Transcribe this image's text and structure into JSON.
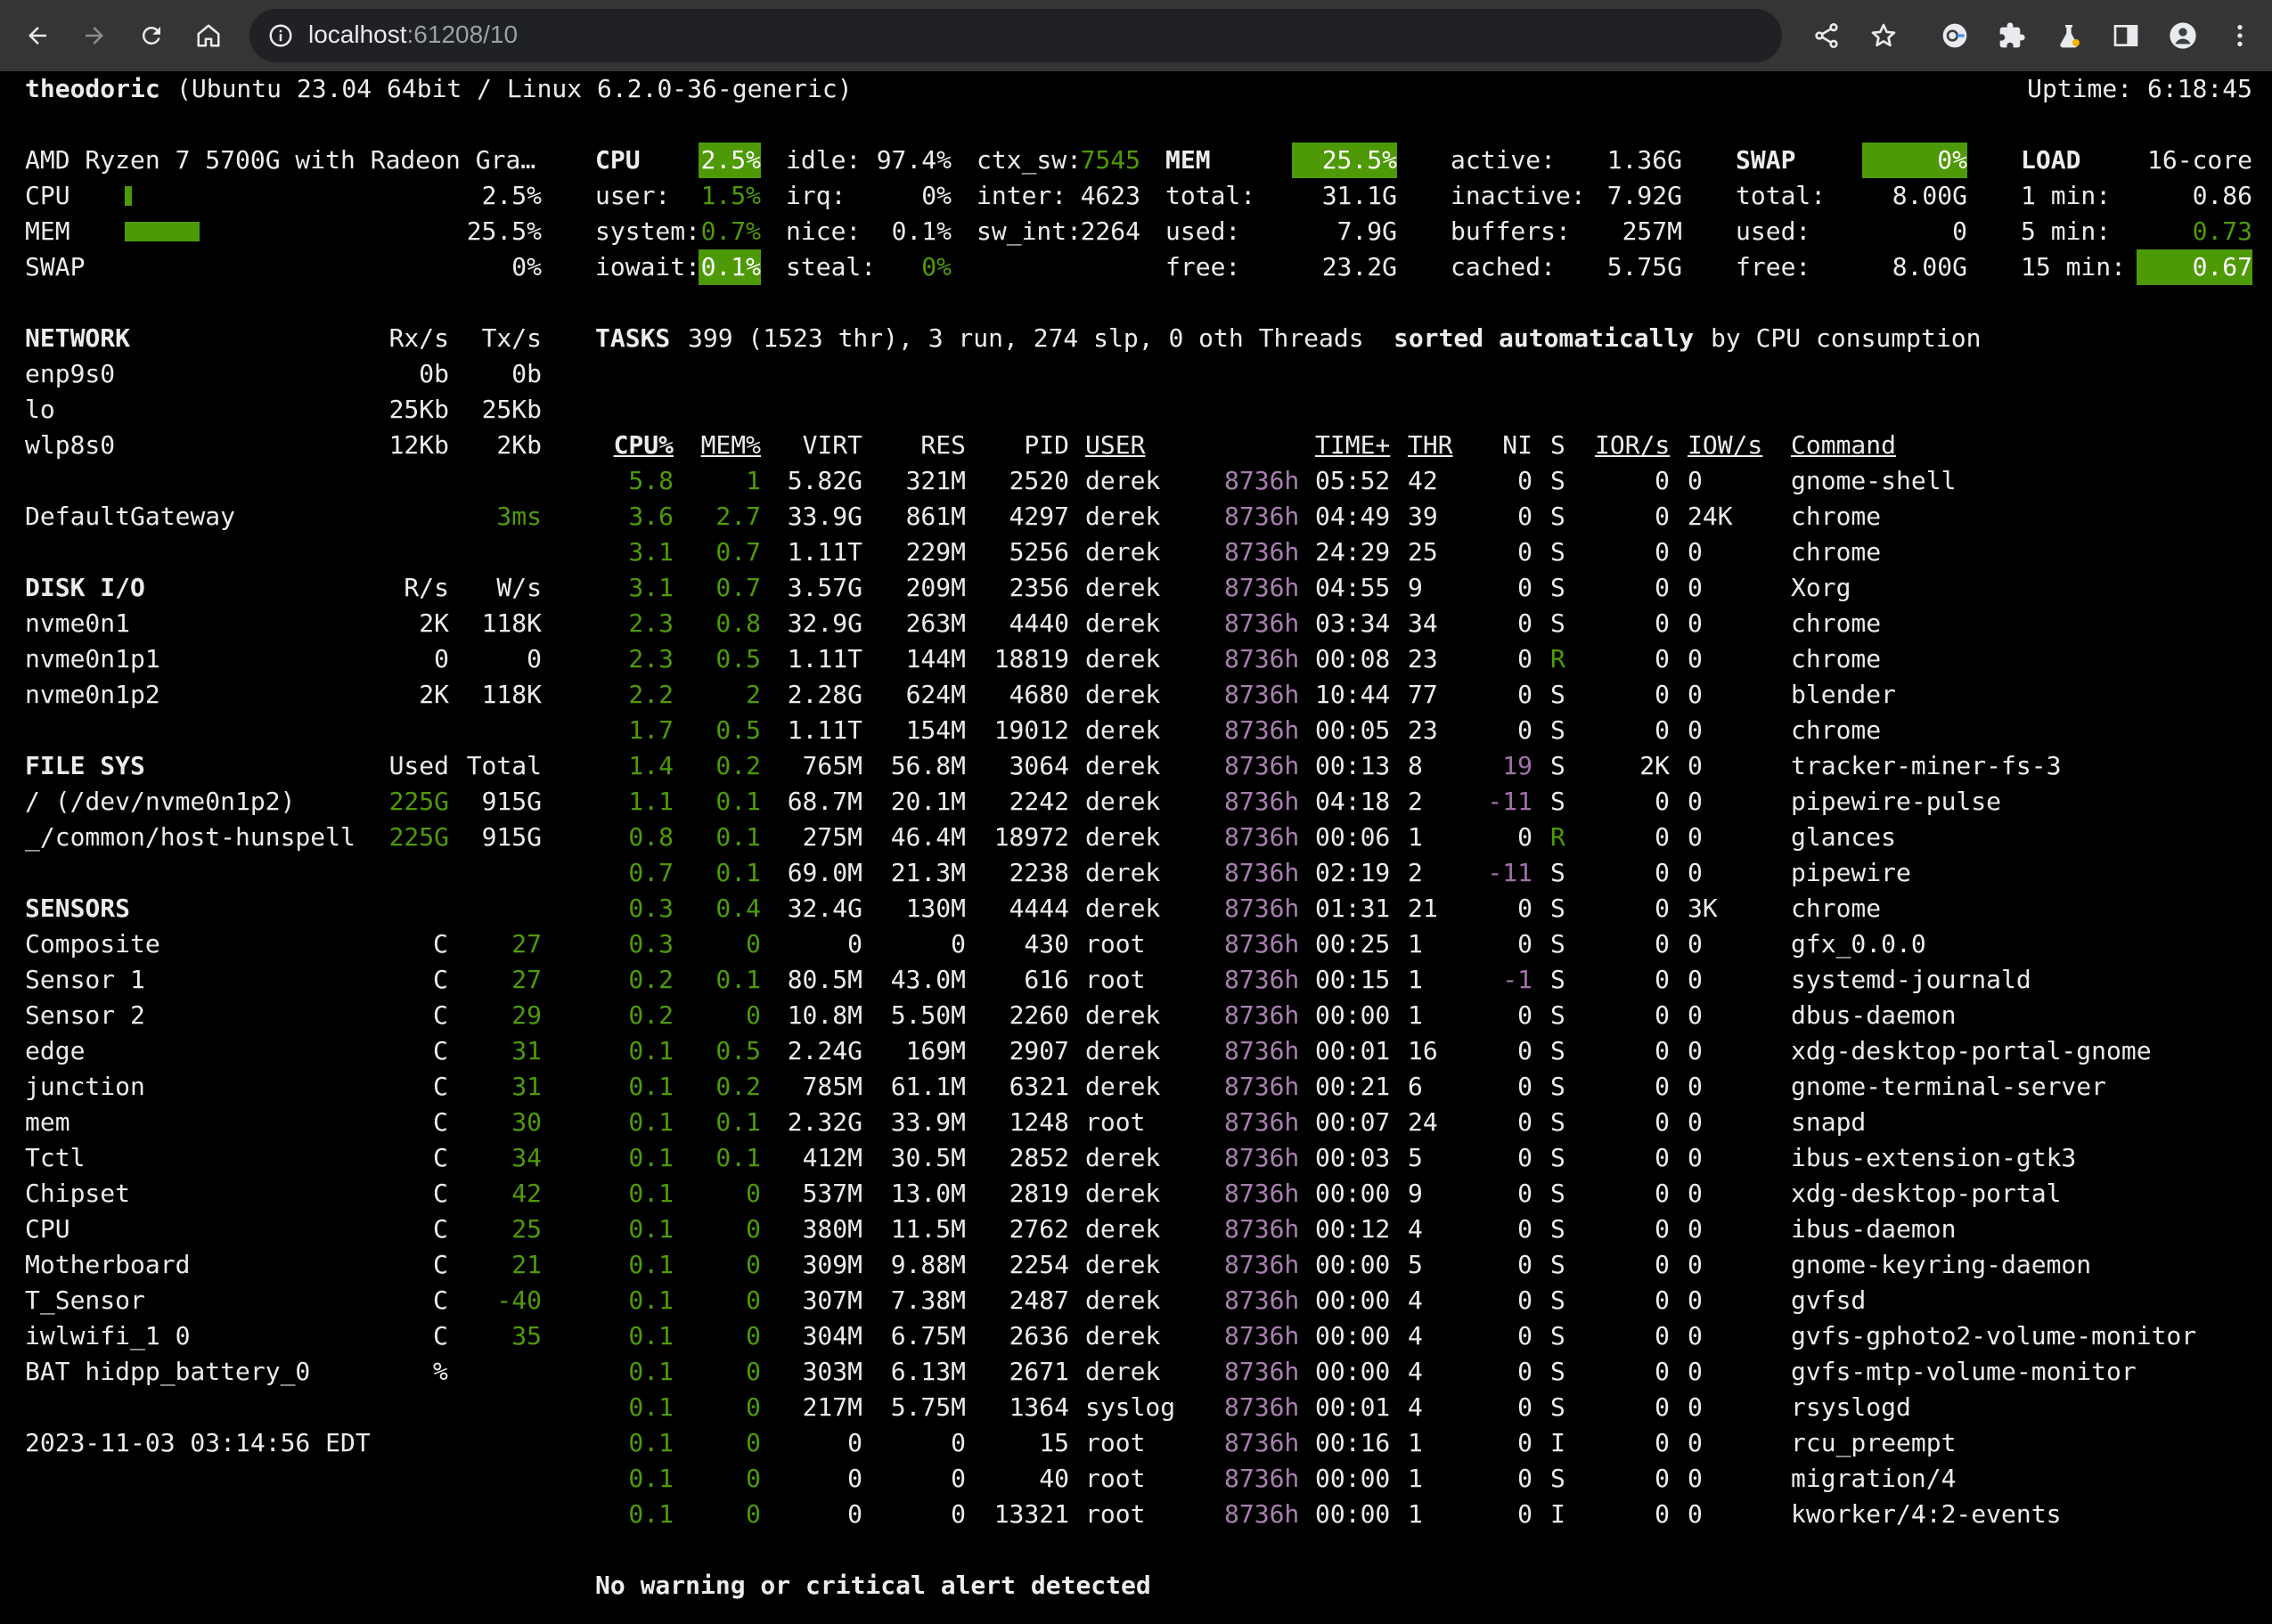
{
  "browser": {
    "url_host": "localhost",
    "url_rest": ":61208/10"
  },
  "header": {
    "hostname": "theodoric",
    "os": "(Ubuntu 23.04 64bit / Linux 6.2.0-36-generic)",
    "uptime": "Uptime: 6:18:45"
  },
  "quicklook": {
    "cpu_name": "AMD Ryzen 7 5700G with Radeon Gra…",
    "rows": [
      {
        "label": "CPU",
        "value": "2.5%",
        "fraction": 0.025
      },
      {
        "label": "MEM",
        "value": "25.5%",
        "fraction": 0.255
      },
      {
        "label": "SWAP",
        "value": "0%",
        "fraction": 0.0
      }
    ]
  },
  "cpu": {
    "title": "CPU",
    "total": "2.5%",
    "user_l": "user:",
    "user": "1.5%",
    "system_l": "system:",
    "system": "0.7%",
    "iowait_l": "iowait:",
    "iowait": "0.1%",
    "idle_l": "idle:",
    "idle": "97.4%",
    "irq_l": "irq:",
    "irq": "0%",
    "nice_l": "nice:",
    "nice": "0.1%",
    "steal_l": "steal:",
    "steal": "0%",
    "ctx_l": "ctx_sw:",
    "ctx": "7545",
    "inter_l": "inter:",
    "inter": "4623",
    "swint_l": "sw_int:",
    "swint": "2264"
  },
  "mem": {
    "title": "MEM",
    "pct": "25.5%",
    "total_l": "total:",
    "total": "31.1G",
    "used_l": "used:",
    "used": "7.9G",
    "free_l": "free:",
    "free": "23.2G",
    "active_l": "active:",
    "active": "1.36G",
    "inactive_l": "inactive:",
    "inactive": "7.92G",
    "buffers_l": "buffers:",
    "buffers": "257M",
    "cached_l": "cached:",
    "cached": "5.75G"
  },
  "swap": {
    "title": "SWAP",
    "pct": "0%",
    "total_l": "total:",
    "total": "8.00G",
    "used_l": "used:",
    "used": "0",
    "free_l": "free:",
    "free": "8.00G"
  },
  "load": {
    "title": "LOAD",
    "cores": "16-core",
    "m1_l": "1 min:",
    "m1": "0.86",
    "m5_l": "5 min:",
    "m5": "0.73",
    "m15_l": "15 min:",
    "m15": "0.67"
  },
  "network": {
    "title": "NETWORK",
    "rx": "Rx/s",
    "tx": "Tx/s",
    "rows": [
      {
        "name": "enp9s0",
        "rx": "0b",
        "tx": "0b"
      },
      {
        "name": "lo",
        "rx": "25Kb",
        "tx": "25Kb"
      },
      {
        "name": "wlp8s0",
        "rx": "12Kb",
        "tx": "2Kb"
      }
    ]
  },
  "gateway": {
    "name": "DefaultGateway",
    "value": "3ms"
  },
  "disk": {
    "title": "DISK I/O",
    "r": "R/s",
    "w": "W/s",
    "rows": [
      {
        "name": "nvme0n1",
        "r": "2K",
        "w": "118K"
      },
      {
        "name": "nvme0n1p1",
        "r": "0",
        "w": "0"
      },
      {
        "name": "nvme0n1p2",
        "r": "2K",
        "w": "118K"
      }
    ]
  },
  "fs": {
    "title": "FILE SYS",
    "used": "Used",
    "total": "Total",
    "rows": [
      {
        "name": "/ (/dev/nvme0n1p2)",
        "used": "225G",
        "total": "915G"
      },
      {
        "name": "_/common/host-hunspell",
        "used": "225G",
        "total": "915G"
      }
    ]
  },
  "sensors": {
    "title": "SENSORS",
    "rows": [
      {
        "name": "Composite",
        "unit": "C",
        "value": "27"
      },
      {
        "name": "Sensor 1",
        "unit": "C",
        "value": "27"
      },
      {
        "name": "Sensor 2",
        "unit": "C",
        "value": "29"
      },
      {
        "name": "edge",
        "unit": "C",
        "value": "31"
      },
      {
        "name": "junction",
        "unit": "C",
        "value": "31"
      },
      {
        "name": "mem",
        "unit": "C",
        "value": "30"
      },
      {
        "name": "Tctl",
        "unit": "C",
        "value": "34"
      },
      {
        "name": "Chipset",
        "unit": "C",
        "value": "42"
      },
      {
        "name": "CPU",
        "unit": "C",
        "value": "25"
      },
      {
        "name": "Motherboard",
        "unit": "C",
        "value": "21"
      },
      {
        "name": "T_Sensor",
        "unit": "C",
        "value": "-40"
      },
      {
        "name": "iwlwifi_1 0",
        "unit": "C",
        "value": "35"
      },
      {
        "name": "BAT hidpp_battery_0",
        "unit": "%",
        "value": ""
      }
    ]
  },
  "datetime": "2023-11-03 03:14:56 EDT",
  "tasks": {
    "title": "TASKS",
    "summary": "399 (1523 thr), 3 run, 274 slp, 0 oth Threads",
    "sorted": "sorted automatically",
    "by": "by CPU consumption"
  },
  "proc_headers": {
    "cpu": "CPU%",
    "mem": "MEM%",
    "virt": "VIRT",
    "res": "RES",
    "pid": "PID",
    "user": "USER",
    "time": "TIME+",
    "thr": "THR",
    "ni": "NI",
    "s": "S",
    "ior": "IOR/s",
    "iow": "IOW/s",
    "cmd": "Command"
  },
  "processes": [
    {
      "cpu": "5.8",
      "mem": "1",
      "virt": "5.82G",
      "res": "321M",
      "pid": "2520",
      "user": "derek",
      "th": "8736h",
      "tm": "05:52",
      "thr": "42",
      "ni": "0",
      "s": "S",
      "ior": "0",
      "iow": "0",
      "cmd": "gnome-shell"
    },
    {
      "cpu": "3.6",
      "mem": "2.7",
      "virt": "33.9G",
      "res": "861M",
      "pid": "4297",
      "user": "derek",
      "th": "8736h",
      "tm": "04:49",
      "thr": "39",
      "ni": "0",
      "s": "S",
      "ior": "0",
      "iow": "24K",
      "cmd": "chrome"
    },
    {
      "cpu": "3.1",
      "mem": "0.7",
      "virt": "1.11T",
      "res": "229M",
      "pid": "5256",
      "user": "derek",
      "th": "8736h",
      "tm": "24:29",
      "thr": "25",
      "ni": "0",
      "s": "S",
      "ior": "0",
      "iow": "0",
      "cmd": "chrome"
    },
    {
      "cpu": "3.1",
      "mem": "0.7",
      "virt": "3.57G",
      "res": "209M",
      "pid": "2356",
      "user": "derek",
      "th": "8736h",
      "tm": "04:55",
      "thr": "9",
      "ni": "0",
      "s": "S",
      "ior": "0",
      "iow": "0",
      "cmd": "Xorg"
    },
    {
      "cpu": "2.3",
      "mem": "0.8",
      "virt": "32.9G",
      "res": "263M",
      "pid": "4440",
      "user": "derek",
      "th": "8736h",
      "tm": "03:34",
      "thr": "34",
      "ni": "0",
      "s": "S",
      "ior": "0",
      "iow": "0",
      "cmd": "chrome"
    },
    {
      "cpu": "2.3",
      "mem": "0.5",
      "virt": "1.11T",
      "res": "144M",
      "pid": "18819",
      "user": "derek",
      "th": "8736h",
      "tm": "00:08",
      "thr": "23",
      "ni": "0",
      "s": "R",
      "ior": "0",
      "iow": "0",
      "cmd": "chrome"
    },
    {
      "cpu": "2.2",
      "mem": "2",
      "virt": "2.28G",
      "res": "624M",
      "pid": "4680",
      "user": "derek",
      "th": "8736h",
      "tm": "10:44",
      "thr": "77",
      "ni": "0",
      "s": "S",
      "ior": "0",
      "iow": "0",
      "cmd": "blender"
    },
    {
      "cpu": "1.7",
      "mem": "0.5",
      "virt": "1.11T",
      "res": "154M",
      "pid": "19012",
      "user": "derek",
      "th": "8736h",
      "tm": "00:05",
      "thr": "23",
      "ni": "0",
      "s": "S",
      "ior": "0",
      "iow": "0",
      "cmd": "chrome"
    },
    {
      "cpu": "1.4",
      "mem": "0.2",
      "virt": "765M",
      "res": "56.8M",
      "pid": "3064",
      "user": "derek",
      "th": "8736h",
      "tm": "00:13",
      "thr": "8",
      "ni": "19",
      "s": "S",
      "ior": "2K",
      "iow": "0",
      "cmd": "tracker-miner-fs-3"
    },
    {
      "cpu": "1.1",
      "mem": "0.1",
      "virt": "68.7M",
      "res": "20.1M",
      "pid": "2242",
      "user": "derek",
      "th": "8736h",
      "tm": "04:18",
      "thr": "2",
      "ni": "-11",
      "s": "S",
      "ior": "0",
      "iow": "0",
      "cmd": "pipewire-pulse"
    },
    {
      "cpu": "0.8",
      "mem": "0.1",
      "virt": "275M",
      "res": "46.4M",
      "pid": "18972",
      "user": "derek",
      "th": "8736h",
      "tm": "00:06",
      "thr": "1",
      "ni": "0",
      "s": "R",
      "ior": "0",
      "iow": "0",
      "cmd": "glances"
    },
    {
      "cpu": "0.7",
      "mem": "0.1",
      "virt": "69.0M",
      "res": "21.3M",
      "pid": "2238",
      "user": "derek",
      "th": "8736h",
      "tm": "02:19",
      "thr": "2",
      "ni": "-11",
      "s": "S",
      "ior": "0",
      "iow": "0",
      "cmd": "pipewire"
    },
    {
      "cpu": "0.3",
      "mem": "0.4",
      "virt": "32.4G",
      "res": "130M",
      "pid": "4444",
      "user": "derek",
      "th": "8736h",
      "tm": "01:31",
      "thr": "21",
      "ni": "0",
      "s": "S",
      "ior": "0",
      "iow": "3K",
      "cmd": "chrome"
    },
    {
      "cpu": "0.3",
      "mem": "0",
      "virt": "0",
      "res": "0",
      "pid": "430",
      "user": "root",
      "th": "8736h",
      "tm": "00:25",
      "thr": "1",
      "ni": "0",
      "s": "S",
      "ior": "0",
      "iow": "0",
      "cmd": "gfx_0.0.0"
    },
    {
      "cpu": "0.2",
      "mem": "0.1",
      "virt": "80.5M",
      "res": "43.0M",
      "pid": "616",
      "user": "root",
      "th": "8736h",
      "tm": "00:15",
      "thr": "1",
      "ni": "-1",
      "s": "S",
      "ior": "0",
      "iow": "0",
      "cmd": "systemd-journald"
    },
    {
      "cpu": "0.2",
      "mem": "0",
      "virt": "10.8M",
      "res": "5.50M",
      "pid": "2260",
      "user": "derek",
      "th": "8736h",
      "tm": "00:00",
      "thr": "1",
      "ni": "0",
      "s": "S",
      "ior": "0",
      "iow": "0",
      "cmd": "dbus-daemon"
    },
    {
      "cpu": "0.1",
      "mem": "0.5",
      "virt": "2.24G",
      "res": "169M",
      "pid": "2907",
      "user": "derek",
      "th": "8736h",
      "tm": "00:01",
      "thr": "16",
      "ni": "0",
      "s": "S",
      "ior": "0",
      "iow": "0",
      "cmd": "xdg-desktop-portal-gnome"
    },
    {
      "cpu": "0.1",
      "mem": "0.2",
      "virt": "785M",
      "res": "61.1M",
      "pid": "6321",
      "user": "derek",
      "th": "8736h",
      "tm": "00:21",
      "thr": "6",
      "ni": "0",
      "s": "S",
      "ior": "0",
      "iow": "0",
      "cmd": "gnome-terminal-server"
    },
    {
      "cpu": "0.1",
      "mem": "0.1",
      "virt": "2.32G",
      "res": "33.9M",
      "pid": "1248",
      "user": "root",
      "th": "8736h",
      "tm": "00:07",
      "thr": "24",
      "ni": "0",
      "s": "S",
      "ior": "0",
      "iow": "0",
      "cmd": "snapd"
    },
    {
      "cpu": "0.1",
      "mem": "0.1",
      "virt": "412M",
      "res": "30.5M",
      "pid": "2852",
      "user": "derek",
      "th": "8736h",
      "tm": "00:03",
      "thr": "5",
      "ni": "0",
      "s": "S",
      "ior": "0",
      "iow": "0",
      "cmd": "ibus-extension-gtk3"
    },
    {
      "cpu": "0.1",
      "mem": "0",
      "virt": "537M",
      "res": "13.0M",
      "pid": "2819",
      "user": "derek",
      "th": "8736h",
      "tm": "00:00",
      "thr": "9",
      "ni": "0",
      "s": "S",
      "ior": "0",
      "iow": "0",
      "cmd": "xdg-desktop-portal"
    },
    {
      "cpu": "0.1",
      "mem": "0",
      "virt": "380M",
      "res": "11.5M",
      "pid": "2762",
      "user": "derek",
      "th": "8736h",
      "tm": "00:12",
      "thr": "4",
      "ni": "0",
      "s": "S",
      "ior": "0",
      "iow": "0",
      "cmd": "ibus-daemon"
    },
    {
      "cpu": "0.1",
      "mem": "0",
      "virt": "309M",
      "res": "9.88M",
      "pid": "2254",
      "user": "derek",
      "th": "8736h",
      "tm": "00:00",
      "thr": "5",
      "ni": "0",
      "s": "S",
      "ior": "0",
      "iow": "0",
      "cmd": "gnome-keyring-daemon"
    },
    {
      "cpu": "0.1",
      "mem": "0",
      "virt": "307M",
      "res": "7.38M",
      "pid": "2487",
      "user": "derek",
      "th": "8736h",
      "tm": "00:00",
      "thr": "4",
      "ni": "0",
      "s": "S",
      "ior": "0",
      "iow": "0",
      "cmd": "gvfsd"
    },
    {
      "cpu": "0.1",
      "mem": "0",
      "virt": "304M",
      "res": "6.75M",
      "pid": "2636",
      "user": "derek",
      "th": "8736h",
      "tm": "00:00",
      "thr": "4",
      "ni": "0",
      "s": "S",
      "ior": "0",
      "iow": "0",
      "cmd": "gvfs-gphoto2-volume-monitor"
    },
    {
      "cpu": "0.1",
      "mem": "0",
      "virt": "303M",
      "res": "6.13M",
      "pid": "2671",
      "user": "derek",
      "th": "8736h",
      "tm": "00:00",
      "thr": "4",
      "ni": "0",
      "s": "S",
      "ior": "0",
      "iow": "0",
      "cmd": "gvfs-mtp-volume-monitor"
    },
    {
      "cpu": "0.1",
      "mem": "0",
      "virt": "217M",
      "res": "5.75M",
      "pid": "1364",
      "user": "syslog",
      "th": "8736h",
      "tm": "00:01",
      "thr": "4",
      "ni": "0",
      "s": "S",
      "ior": "0",
      "iow": "0",
      "cmd": "rsyslogd"
    },
    {
      "cpu": "0.1",
      "mem": "0",
      "virt": "0",
      "res": "0",
      "pid": "15",
      "user": "root",
      "th": "8736h",
      "tm": "00:16",
      "thr": "1",
      "ni": "0",
      "s": "I",
      "ior": "0",
      "iow": "0",
      "cmd": "rcu_preempt"
    },
    {
      "cpu": "0.1",
      "mem": "0",
      "virt": "0",
      "res": "0",
      "pid": "40",
      "user": "root",
      "th": "8736h",
      "tm": "00:00",
      "thr": "1",
      "ni": "0",
      "s": "S",
      "ior": "0",
      "iow": "0",
      "cmd": "migration/4"
    },
    {
      "cpu": "0.1",
      "mem": "0",
      "virt": "0",
      "res": "0",
      "pid": "13321",
      "user": "root",
      "th": "8736h",
      "tm": "00:00",
      "thr": "1",
      "ni": "0",
      "s": "I",
      "ior": "0",
      "iow": "0",
      "cmd": "kworker/4:2-events"
    }
  ],
  "alert": "No warning or critical alert detected"
}
